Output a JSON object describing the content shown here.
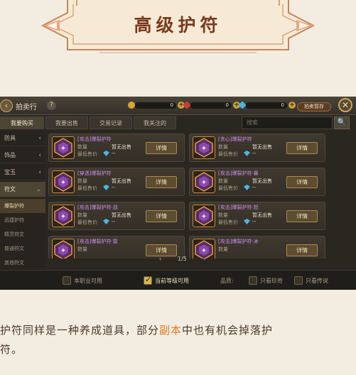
{
  "banner": {
    "title": "高级护符"
  },
  "game": {
    "topbar": {
      "title": "拍卖行",
      "help": "?",
      "currencies": [
        {
          "icon": "gold-coin-icon",
          "value": "0",
          "color": "#d9a531"
        },
        {
          "icon": "red-gem-icon",
          "value": "0",
          "color": "#d03a3a"
        },
        {
          "icon": "blue-gem-icon",
          "value": "0",
          "color": "#4ab6e6"
        }
      ],
      "storage": "拍卖暂存",
      "close": "✕",
      "back": "‹"
    },
    "tabs": [
      "我要购买",
      "我要出售",
      "交易记录",
      "我关注的"
    ],
    "search_placeholder": "搜索",
    "search_icon": "🔍",
    "sidebar": {
      "items": [
        {
          "label": "防具",
          "chev": "‹"
        },
        {
          "label": "饰品",
          "chev": "‹"
        },
        {
          "label": "宝玉",
          "chev": "‹"
        },
        {
          "label": "符文",
          "chev": "⌄"
        }
      ],
      "subs": [
        "爆裂护符",
        "迅捷护符",
        "精灵符文",
        "普通符文",
        "其他符文"
      ]
    },
    "cards": [
      {
        "name": "[攻击]爆裂护符",
        "qty_label": "数量",
        "status": "暂无出售",
        "lp_label": "最低售价",
        "price": "--",
        "btn": "详情"
      },
      {
        "name": "[贪心]爆裂护符",
        "qty_label": "数量",
        "status": "暂无出售",
        "lp_label": "最低售价",
        "price": "--",
        "btn": "详情"
      },
      {
        "name": "[穿透]爆裂护符",
        "qty_label": "数量",
        "status": "暂无出售",
        "lp_label": "最低售价",
        "price": "--",
        "btn": "详情"
      },
      {
        "name": "[攻击]爆裂护符·暴",
        "qty_label": "数量",
        "status": "暂无出售",
        "lp_label": "最低售价",
        "price": "--",
        "btn": "详情"
      },
      {
        "name": "[攻击]爆裂护符·战",
        "qty_label": "数量",
        "status": "暂无出售",
        "lp_label": "最低售价",
        "price": "--",
        "btn": "详情"
      },
      {
        "name": "[攻击]爆裂护符·怒",
        "qty_label": "数量",
        "status": "暂无出售",
        "lp_label": "最低售价",
        "price": "--",
        "btn": "详情"
      },
      {
        "name": "[攻击]爆裂护符·雷",
        "qty_label": "数量",
        "status": "",
        "lp_label": "",
        "price": "",
        "btn": "详情"
      },
      {
        "name": "[攻击]爆裂护符·冰",
        "qty_label": "数量",
        "status": "",
        "lp_label": "",
        "price": "",
        "btn": "详情"
      }
    ],
    "pager": {
      "prev": "‹",
      "page": "1/5",
      "next": "›"
    },
    "filters": [
      {
        "label": "本职业可用",
        "checked": false
      },
      {
        "label": "当前等级可用",
        "checked": true
      },
      {
        "label": "品质:",
        "checked": null
      },
      {
        "label": "只看珍奇",
        "checked": false
      },
      {
        "label": "只看传说",
        "checked": false
      }
    ]
  },
  "caption": {
    "line1_a": "护符同样是一种养成道具，部分",
    "line1_hl": "副本",
    "line1_b": "中也有机会掉落护",
    "line2": "符。"
  }
}
